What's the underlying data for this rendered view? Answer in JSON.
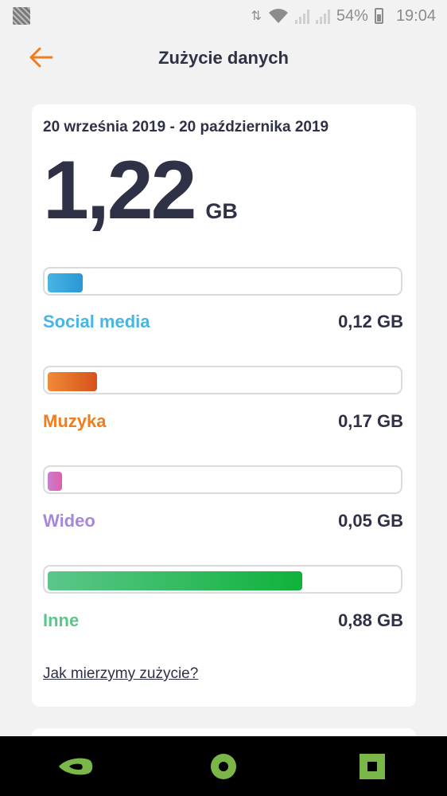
{
  "statusbar": {
    "battery": "54%",
    "time": "19:04"
  },
  "header": {
    "title": "Zużycie danych"
  },
  "usage": {
    "period": "20 września 2019 - 20 października 2019",
    "total_value": "1,22",
    "total_unit": "GB",
    "categories": [
      {
        "label": "Social media",
        "amount": "0,12 GB",
        "fraction": 0.098,
        "color": "#3aaee0"
      },
      {
        "label": "Muzyka",
        "amount": "0,17 GB",
        "fraction": 0.139,
        "color": "#ec7a22"
      },
      {
        "label": "Wideo",
        "amount": "0,05 GB",
        "fraction": 0.041,
        "color": "#b07fd8"
      },
      {
        "label": "Inne",
        "amount": "0,88 GB",
        "fraction": 0.721,
        "color": "#40c080"
      }
    ],
    "link": "Jak mierzymy zużycie?"
  },
  "colors": {
    "accent": "#f07d1e",
    "text": "#2f3146",
    "social_media": "#48b5e3",
    "muzyka": "#f07d1e",
    "wideo": "#a688d8",
    "inne": "#5cc68a"
  }
}
